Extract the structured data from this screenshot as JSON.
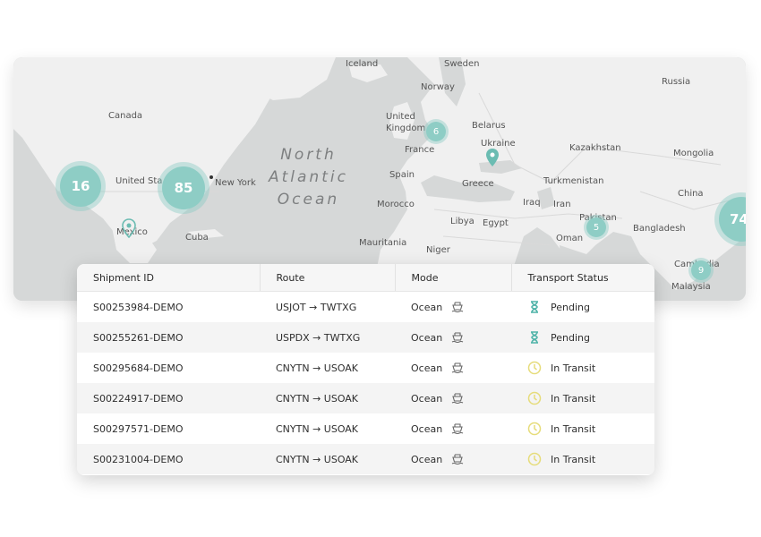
{
  "map": {
    "ocean_label": [
      "North",
      "Atlantic",
      "Ocean"
    ],
    "places": [
      {
        "name": "Iceland"
      },
      {
        "name": "Sweden"
      },
      {
        "name": "Norway"
      },
      {
        "name": "Russia"
      },
      {
        "name": "Canada"
      },
      {
        "name": "United\nKingdom"
      },
      {
        "name": "Belarus"
      },
      {
        "name": "Ukraine"
      },
      {
        "name": "France"
      },
      {
        "name": "Kazakhstan"
      },
      {
        "name": "Mongolia"
      },
      {
        "name": "United Sta"
      },
      {
        "name": "New York"
      },
      {
        "name": "Spain"
      },
      {
        "name": "Greece"
      },
      {
        "name": "Turkmenistan"
      },
      {
        "name": "China"
      },
      {
        "name": "Morocco"
      },
      {
        "name": "Libya"
      },
      {
        "name": "Egypt"
      },
      {
        "name": "Iraq"
      },
      {
        "name": "Iran"
      },
      {
        "name": "Pakistan"
      },
      {
        "name": "Bangladesh"
      },
      {
        "name": "Mexico"
      },
      {
        "name": "Cuba"
      },
      {
        "name": "Mauritania"
      },
      {
        "name": "Niger"
      },
      {
        "name": "Oman"
      },
      {
        "name": "Cambodia"
      },
      {
        "name": "Malaysia"
      }
    ],
    "clusters": [
      {
        "count": "16"
      },
      {
        "count": "85"
      },
      {
        "count": "6"
      },
      {
        "count": "5"
      },
      {
        "count": "9"
      },
      {
        "count": "74"
      }
    ],
    "colors": {
      "land": "#f0f0f0",
      "water": "#d6d8d8",
      "cluster": "#8ecdc5",
      "pin": "#6bbcb2"
    }
  },
  "table": {
    "columns": [
      "Shipment ID",
      "Route",
      "Mode",
      "Transport Status"
    ],
    "rows": [
      {
        "id": "S00253984-DEMO",
        "route": "USJOT → TWTXG",
        "mode": "Ocean",
        "status": "Pending",
        "status_icon": "hourglass-icon"
      },
      {
        "id": "S00255261-DEMO",
        "route": "USPDX → TWTXG",
        "mode": "Ocean",
        "status": "Pending",
        "status_icon": "hourglass-icon"
      },
      {
        "id": "S00295684-DEMO",
        "route": "CNYTN → USOAK",
        "mode": "Ocean",
        "status": "In Transit",
        "status_icon": "clock-icon"
      },
      {
        "id": "S00224917-DEMO",
        "route": "CNYTN → USOAK",
        "mode": "Ocean",
        "status": "In Transit",
        "status_icon": "clock-icon"
      },
      {
        "id": "S00297571-DEMO",
        "route": "CNYTN → USOAK",
        "mode": "Ocean",
        "status": "In Transit",
        "status_icon": "clock-icon"
      },
      {
        "id": "S00231004-DEMO",
        "route": "CNYTN → USOAK",
        "mode": "Ocean",
        "status": "In Transit",
        "status_icon": "clock-icon"
      }
    ],
    "colors": {
      "pending": "#4fb3a8",
      "in_transit": "#e6dc7a"
    }
  }
}
